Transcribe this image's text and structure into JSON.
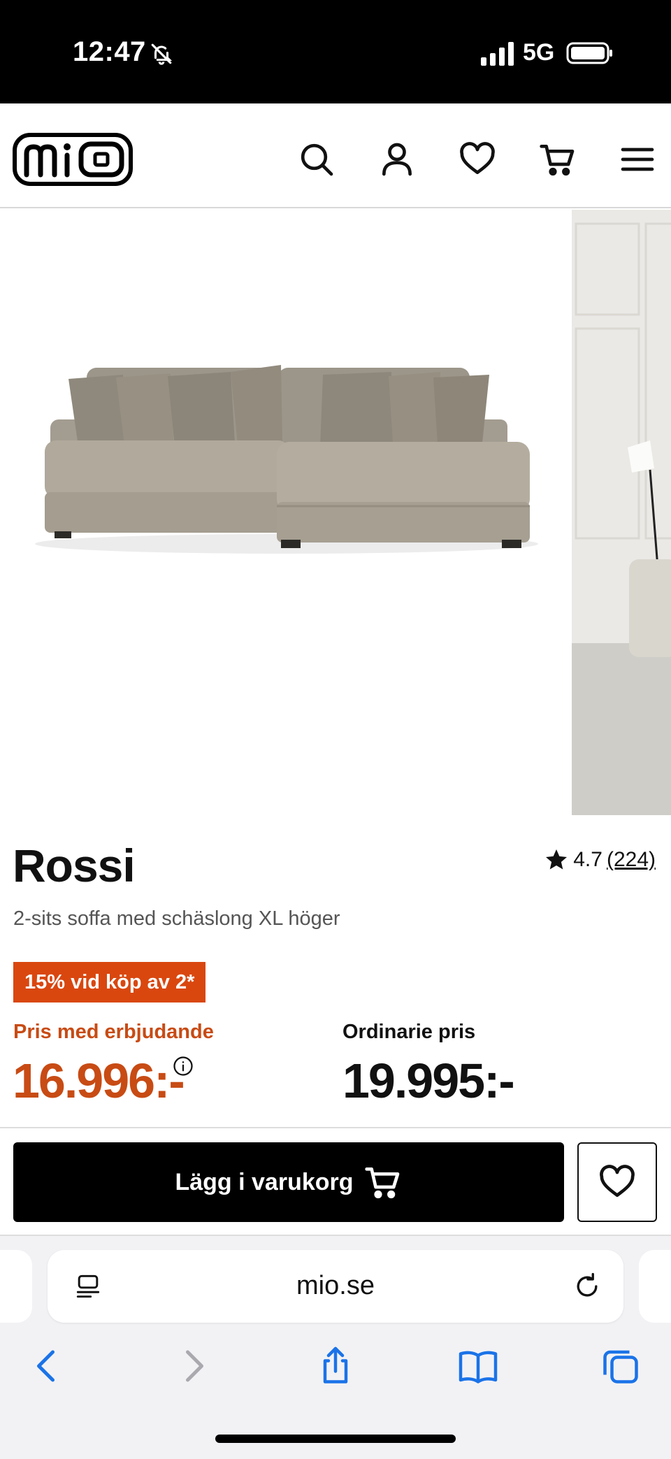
{
  "status_bar": {
    "time": "12:47",
    "network": "5G"
  },
  "header": {
    "logo_alt": "mio",
    "icons": [
      "search-icon",
      "account-icon",
      "heart-icon",
      "cart-icon",
      "menu-icon"
    ]
  },
  "product": {
    "name": "Rossi",
    "rating": "4.7",
    "review_count": "(224)",
    "description": "2-sits soffa med schäslong XL höger",
    "promo_badge": "15% vid köp av 2*",
    "offer_label": "Pris med erbjudande",
    "offer_price": "16.996:-",
    "regular_label": "Ordinarie pris",
    "regular_price": "19.995:-"
  },
  "actions": {
    "add_to_cart": "Lägg i varukorg"
  },
  "browser": {
    "url": "mio.se"
  },
  "colors": {
    "accent_orange": "#d9470f",
    "price_orange": "#c84b14",
    "button_black": "#000000",
    "sofa": "#a59e91"
  }
}
